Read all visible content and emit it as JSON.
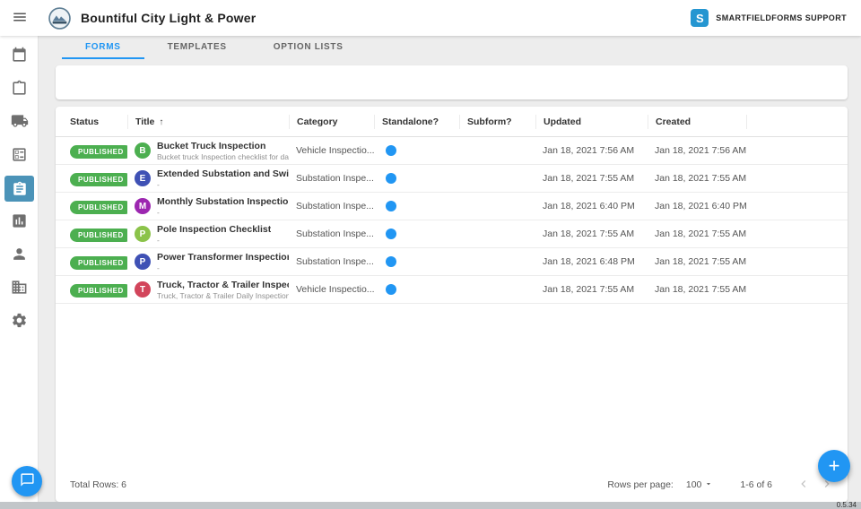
{
  "colors": {
    "accent": "#2196f3",
    "published": "#4caf50",
    "sidebar_selected": "#4b93b8"
  },
  "topbar": {
    "title": "Bountiful City Light & Power",
    "brand_letter": "S",
    "support_label": "SMARTFIELDFORMS SUPPORT"
  },
  "sidebar": {
    "items": [
      {
        "icon": "calendar-icon"
      },
      {
        "icon": "clipboard-icon"
      },
      {
        "icon": "truck-icon"
      },
      {
        "icon": "ballot-icon"
      },
      {
        "icon": "forms-icon",
        "selected": true
      },
      {
        "icon": "chart-icon"
      },
      {
        "icon": "person-icon"
      },
      {
        "icon": "building-icon"
      },
      {
        "icon": "settings-icon"
      }
    ]
  },
  "tabs": [
    {
      "label": "FORMS",
      "active": true
    },
    {
      "label": "TEMPLATES",
      "active": false
    },
    {
      "label": "OPTION LISTS",
      "active": false
    }
  ],
  "table": {
    "columns": {
      "status": "Status",
      "title": "Title",
      "sort_indicator": "↑",
      "category": "Category",
      "standalone": "Standalone?",
      "subform": "Subform?",
      "updated": "Updated",
      "created": "Created"
    },
    "rows": [
      {
        "status": "PUBLISHED",
        "avatar_letter": "B",
        "avatar_color": "#4caf50",
        "title": "Bucket Truck Inspection",
        "subtitle": "Bucket truck Inspection checklist for daily, ...",
        "category": "Vehicle Inspectio...",
        "standalone": true,
        "subform": "",
        "updated": "Jan 18, 2021 7:56 AM",
        "created": "Jan 18, 2021 7:56 AM"
      },
      {
        "status": "PUBLISHED",
        "avatar_letter": "E",
        "avatar_color": "#3f51b5",
        "title": "Extended Substation and Switching...",
        "subtitle": "-",
        "category": "Substation Inspe...",
        "standalone": true,
        "subform": "",
        "updated": "Jan 18, 2021 7:55 AM",
        "created": "Jan 18, 2021 7:55 AM"
      },
      {
        "status": "PUBLISHED",
        "avatar_letter": "M",
        "avatar_color": "#9c27b0",
        "title": "Monthly Substation Inspection Wor...",
        "subtitle": "-",
        "category": "Substation Inspe...",
        "standalone": true,
        "subform": "",
        "updated": "Jan 18, 2021 6:40 PM",
        "created": "Jan 18, 2021 6:40 PM"
      },
      {
        "status": "PUBLISHED",
        "avatar_letter": "P",
        "avatar_color": "#8bc34a",
        "title": "Pole Inspection Checklist",
        "subtitle": "-",
        "category": "Substation Inspe...",
        "standalone": true,
        "subform": "",
        "updated": "Jan 18, 2021 7:55 AM",
        "created": "Jan 18, 2021 7:55 AM"
      },
      {
        "status": "PUBLISHED",
        "avatar_letter": "P",
        "avatar_color": "#3f51b5",
        "title": "Power Transformer Inspection",
        "subtitle": "-",
        "category": "Substation Inspe...",
        "standalone": true,
        "subform": "",
        "updated": "Jan 18, 2021 6:48 PM",
        "created": "Jan 18, 2021 7:55 AM"
      },
      {
        "status": "PUBLISHED",
        "avatar_letter": "T",
        "avatar_color": "#d2455b",
        "title": "Truck, Tractor & Trailer Inspection",
        "subtitle": "Truck, Tractor & Trailer Daily Inspection For...",
        "category": "Vehicle Inspectio...",
        "standalone": true,
        "subform": "",
        "updated": "Jan 18, 2021 7:55 AM",
        "created": "Jan 18, 2021 7:55 AM"
      }
    ]
  },
  "footer": {
    "total_rows": "Total Rows: 6",
    "rows_per_page_label": "Rows per page:",
    "rows_per_page_value": "100",
    "range": "1-6 of 6"
  },
  "fab_label": "+",
  "version": "0.5.34"
}
